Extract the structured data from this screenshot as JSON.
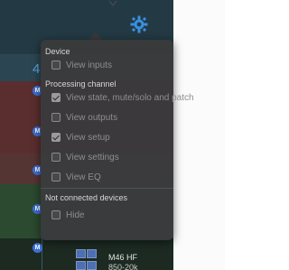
{
  "popover": {
    "sections": {
      "device": "Device",
      "processing": "Processing channel",
      "not_connected": "Not connected devices"
    },
    "options": {
      "view_inputs": {
        "label": "View inputs",
        "checked": false
      },
      "view_state": {
        "label": "View state, mute/solo and patch",
        "checked": true
      },
      "view_outputs": {
        "label": "View outputs",
        "checked": false
      },
      "view_setup": {
        "label": "View setup",
        "checked": true
      },
      "view_settings": {
        "label": "View settings",
        "checked": false
      },
      "view_eq": {
        "label": "View EQ",
        "checked": false
      },
      "hide": {
        "label": "Hide",
        "checked": false
      }
    }
  },
  "mixer": {
    "channel_number": "4",
    "badge": "M",
    "bottom_label_1": "M46 HF",
    "bottom_label_2": "850-20k"
  },
  "icons": {
    "settings": "gear-icon",
    "arrow": "arrow-down-icon"
  }
}
